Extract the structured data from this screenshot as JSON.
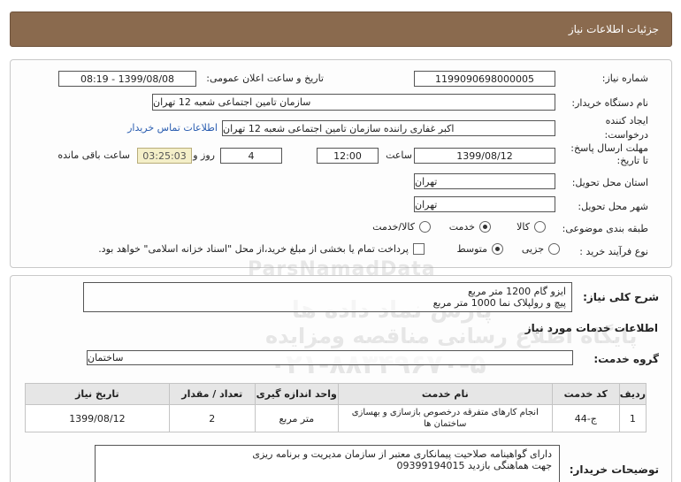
{
  "header": {
    "title": "جزئیات اطلاعات نیاز"
  },
  "fields": {
    "need_number_label": "شماره نیاز:",
    "need_number": "1199090698000005",
    "announce_label": "تاریخ و ساعت اعلان عمومی:",
    "announce_value": "1399/08/08 - 08:19",
    "buyer_label": "نام دستگاه خریدار:",
    "buyer_value": "سازمان تامین اجتماعی شعبه 12 تهران",
    "creator_label_1": "ایجاد کننده",
    "creator_label_2": "درخواست:",
    "creator_value": "اکبر غفاری راننده سازمان تامین اجتماعی شعبه 12 تهران",
    "contact_link": "اطلاعات تماس خریدار",
    "deadline_label_1": "مهلت ارسال پاسخ:",
    "deadline_label_2": "تا تاریخ:",
    "deadline_date": "1399/08/12",
    "time_label": "ساعت",
    "deadline_time": "12:00",
    "days_value": "4",
    "days_label": "روز و",
    "remaining_time": "03:25:03",
    "remaining_label": "ساعت باقی مانده",
    "province_label": "استان محل تحویل:",
    "province_value": "تهران",
    "city_label": "شهر محل تحویل:",
    "city_value": "تهران",
    "category_label": "طبقه بندی موضوعی:",
    "category_options": {
      "goods": "کالا",
      "service": "خدمت",
      "goods_service": "کالا/خدمت"
    },
    "process_label": "نوع فرآیند خرید :",
    "process_options": {
      "partial": "جزیی",
      "medium": "متوسط"
    },
    "payment_note": "پرداخت تمام یا بخشی از مبلغ خرید،از محل \"اسناد خزانه اسلامی\" خواهد بود."
  },
  "description": {
    "label": "شرح کلی نیاز:",
    "line1": "ایزو گام 1200 متر مربع",
    "line2": "پیچ و رولپلاک نما 1000 متر مربع"
  },
  "services": {
    "section_title": "اطلاعات خدمات مورد نیاز",
    "group_label": "گروه خدمت:",
    "group_value": "ساختمان",
    "columns": [
      "ردیف",
      "کد خدمت",
      "نام خدمت",
      "واحد اندازه گیری",
      "تعداد / مقدار",
      "تاریخ نیاز"
    ],
    "rows": [
      [
        "1",
        "ج-44",
        "انجام کارهای متفرقه درخصوص بازسازی و بهسازی ساختمان ها",
        "متر مربع",
        "2",
        "1399/08/12"
      ]
    ]
  },
  "buyer_notes": {
    "label": "توضیحات خریدار:",
    "line1": "دارای گواهینامه صلاحیت پیمانکاری معتبر از سازمان مدیریت و برنامه ریزی",
    "line2": "جهت هماهنگی بازدید 09399194015"
  },
  "watermark": {
    "brand": "ParsNamadData",
    "line1": "پارس نماد داده ها",
    "line2": "پایگاه اطلاع رسانی مناقصه ومزایده",
    "phone": "۰۲۱-۸۸۳۴۹۶۷۰-۵"
  }
}
